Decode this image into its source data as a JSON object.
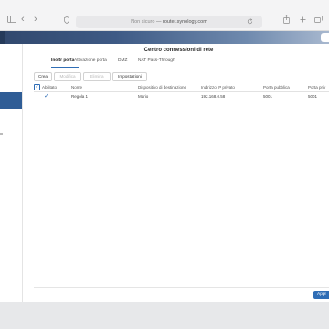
{
  "browser": {
    "not_secure": "Non sicuro",
    "separator": "—",
    "host": "router.synology.com"
  },
  "app": {
    "title": "Centro connessioni di rete"
  },
  "tabs": [
    {
      "label": "Inoltr porta",
      "active": true
    },
    {
      "label": "Attivazione porta",
      "active": false
    },
    {
      "label": "DMZ",
      "active": false
    },
    {
      "label": "NAT Pass-Through",
      "active": false
    }
  ],
  "toolbar": {
    "create": "Crea",
    "edit": "Modifica",
    "delete": "Elimina",
    "settings": "Impostazioni"
  },
  "table": {
    "columns": [
      "Abilitato",
      "Nome",
      "Dispositivo di destinazione",
      "Indirizzo IP privato",
      "Porta pubblica",
      "Porta priv"
    ],
    "rows": [
      {
        "enabled": true,
        "name": "Regola 1",
        "device": "Mario",
        "private_ip": "192.168.0.58",
        "public_port": "5001",
        "private_port": "5001"
      }
    ]
  },
  "footer": {
    "apply": "Appl"
  },
  "colors": {
    "accent": "#2f6db5",
    "sidebar_active": "#2f5d96",
    "dsm_bar": "#3e5a85"
  }
}
